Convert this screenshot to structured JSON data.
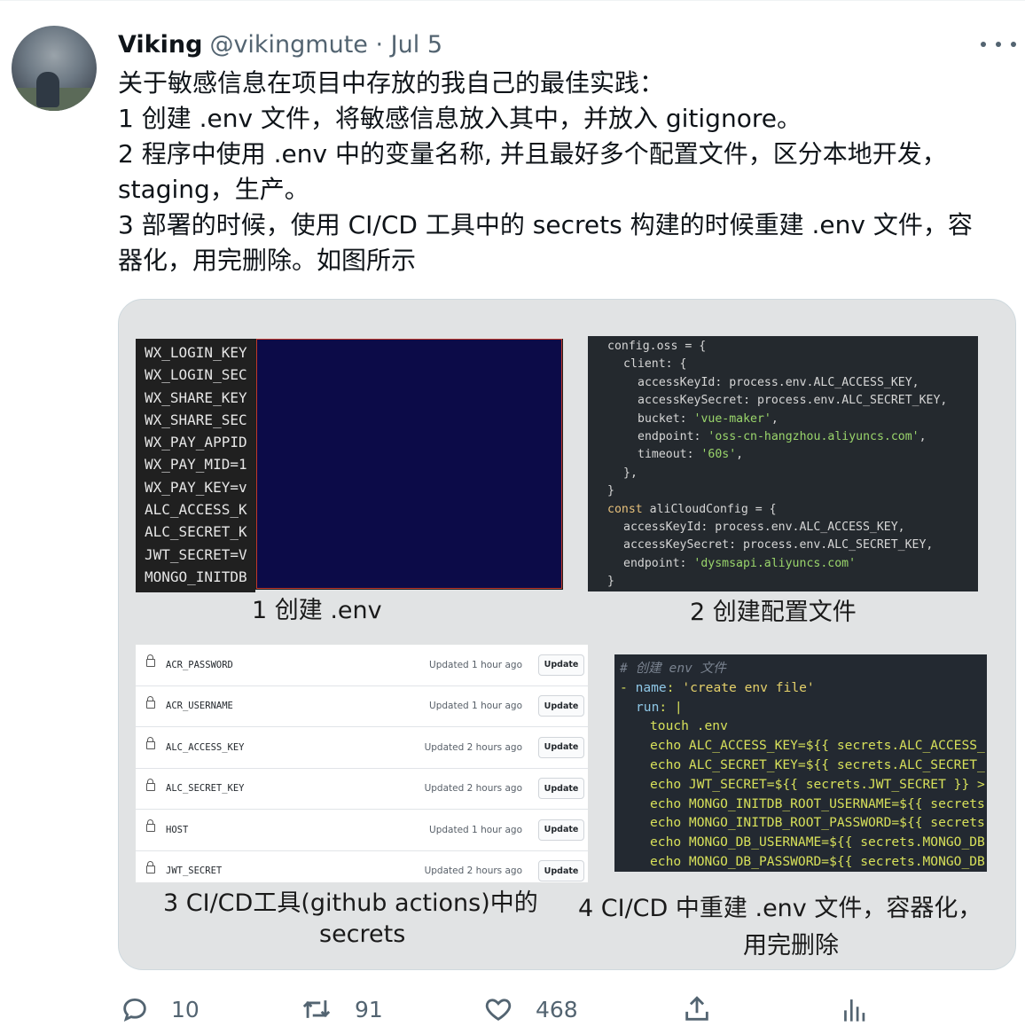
{
  "tweet": {
    "author_name": "Viking",
    "author_handle": "@vikingmute · Jul 5",
    "text_lines": [
      "关于敏感信息在项目中存放的我自己的最佳实践：",
      "1 创建 .env 文件，将敏感信息放入其中，并放入 gitignore。",
      "2 程序中使用 .env 中的变量名称, 并且最好多个配置文件，区分本地开发，",
      "staging，生产。",
      "3 部署的时候，使用 CI/CD 工具中的 secrets 构建的时候重建 .env 文件，容",
      "器化，用完删除。如图所示"
    ]
  },
  "media": {
    "panel1": {
      "env_vars": [
        "WX_LOGIN_KEY",
        "WX_LOGIN_SEC",
        "WX_SHARE_KEY",
        "WX_SHARE_SEC",
        "WX_PAY_APPID",
        "WX_PAY_MID=1",
        "WX_PAY_KEY=v",
        "ALC_ACCESS_K",
        "ALC_SECRET_K",
        "JWT_SECRET=V",
        "MONGO_INITDB"
      ],
      "caption": "1 创建 .env"
    },
    "panel2": {
      "code_lines": [
        "config.oss = {",
        "  client: {",
        "    accessKeyId: process.env.ALC_ACCESS_KEY,",
        "    accessKeySecret: process.env.ALC_SECRET_KEY,",
        "    bucket: 'vue-maker',",
        "    endpoint: 'oss-cn-hangzhou.aliyuncs.com',",
        "    timeout: '60s',",
        "  },",
        "}",
        "const aliCloudConfig = {",
        "  accessKeyId: process.env.ALC_ACCESS_KEY,",
        "  accessKeySecret: process.env.ALC_SECRET_KEY,",
        "  endpoint: 'dysmsapi.aliyuncs.com'",
        "}"
      ],
      "caption": "2 创建配置文件"
    },
    "panel3": {
      "secrets": [
        {
          "name": "ACR_PASSWORD",
          "updated": "Updated 1 hour ago",
          "button": "Update"
        },
        {
          "name": "ACR_USERNAME",
          "updated": "Updated 1 hour ago",
          "button": "Update"
        },
        {
          "name": "ALC_ACCESS_KEY",
          "updated": "Updated 2 hours ago",
          "button": "Update"
        },
        {
          "name": "ALC_SECRET_KEY",
          "updated": "Updated 2 hours ago",
          "button": "Update"
        },
        {
          "name": "HOST",
          "updated": "Updated 1 hour ago",
          "button": "Update"
        },
        {
          "name": "JWT_SECRET",
          "updated": "Updated 2 hours ago",
          "button": "Update"
        }
      ],
      "caption_line1": "3  CI/CD工具(github actions)中的",
      "caption_line2": "secrets"
    },
    "panel4": {
      "code_lines": [
        "# 创建 env 文件",
        "- name: 'create env file'",
        "  run: |",
        "    touch .env",
        "    echo ALC_ACCESS_KEY=${{ secrets.ALC_ACCESS_",
        "    echo ALC_SECRET_KEY=${{ secrets.ALC_SECRET_",
        "    echo JWT_SECRET=${{ secrets.JWT_SECRET }} >",
        "    echo MONGO_INITDB_ROOT_USERNAME=${{ secrets",
        "    echo MONGO_INITDB_ROOT_PASSWORD=${{ secrets",
        "    echo MONGO_DB_USERNAME=${{ secrets.MONGO_DB",
        "    echo MONGO_DB_PASSWORD=${{ secrets.MONGO_DB"
      ],
      "caption_line1": "4 CI/CD 中重建 .env 文件，容器化，",
      "caption_line2": "用完删除"
    }
  },
  "actions": {
    "replies": "10",
    "retweets": "91",
    "likes": "468"
  },
  "icons": {
    "more": "more-icon",
    "reply": "reply-icon",
    "retweet": "retweet-icon",
    "like": "heart-icon",
    "share": "share-icon",
    "analytics": "analytics-icon"
  }
}
